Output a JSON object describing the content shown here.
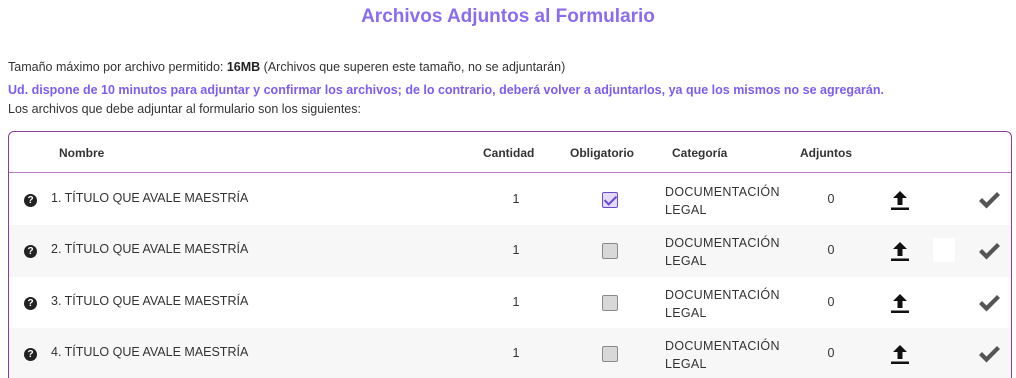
{
  "page": {
    "title": "Archivos Adjuntos al Formulario",
    "max_size_prefix": "Tamaño máximo por archivo permitido: ",
    "max_size_value": "16MB",
    "max_size_suffix": " (Archivos que superen este tamaño, no se adjuntarán)",
    "time_notice": "Ud. dispone de 10 minutos para adjuntar y confirmar los archivos; de lo contrario, deberá volver a adjuntarlos, ya que los mismos no se agregarán.",
    "list_intro": "Los archivos que debe adjuntar al formulario son los siguientes:"
  },
  "table": {
    "headers": {
      "nombre": "Nombre",
      "cantidad": "Cantidad",
      "obligatorio": "Obligatorio",
      "categoria": "Categoría",
      "adjuntos": "Adjuntos"
    },
    "rows": [
      {
        "name": "1. TÍTULO QUE AVALE MAESTRÍA",
        "quantity": "1",
        "required": true,
        "category_line1": "DOCUMENTACIÓN",
        "category_line2": "LEGAL",
        "attachments": "0"
      },
      {
        "name": "2. TÍTULO QUE AVALE MAESTRÍA",
        "quantity": "1",
        "required": false,
        "category_line1": "DOCUMENTACIÓN",
        "category_line2": "LEGAL",
        "attachments": "0"
      },
      {
        "name": "3. TÍTULO QUE AVALE MAESTRÍA",
        "quantity": "1",
        "required": false,
        "category_line1": "DOCUMENTACIÓN",
        "category_line2": "LEGAL",
        "attachments": "0"
      },
      {
        "name": "4. TÍTULO QUE AVALE MAESTRÍA",
        "quantity": "1",
        "required": false,
        "category_line1": "DOCUMENTACIÓN",
        "category_line2": "LEGAL",
        "attachments": "0"
      }
    ],
    "help_icon_glyph": "?"
  },
  "icons": {
    "help": "question-circle-icon",
    "upload": "upload-icon",
    "confirm": "checkmark-icon"
  },
  "colors": {
    "title": "#8a6cf0",
    "notice": "#7d5cf0",
    "panel_border": "#8e3a9e",
    "checkmark": "#555555"
  }
}
